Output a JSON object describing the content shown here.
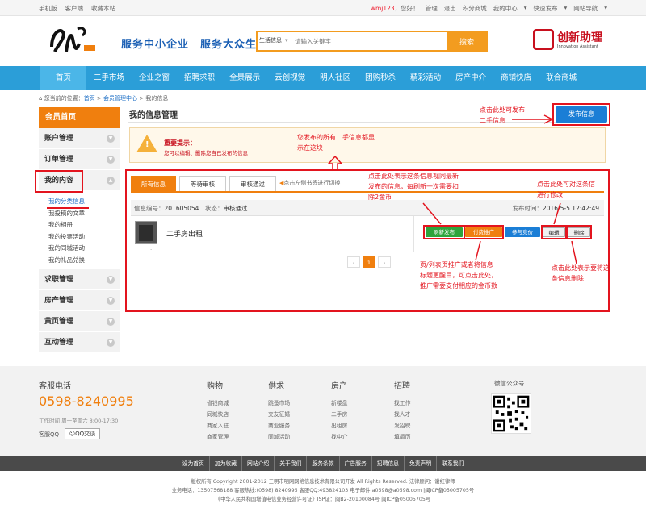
{
  "topbar": {
    "left": [
      "手机版",
      "客户端",
      "收藏本站"
    ],
    "user": "wmj123",
    "greeting": "，您好！",
    "right": [
      "管理",
      "退出",
      "积分商城",
      "我的中心",
      "快速发布",
      "网站导航"
    ]
  },
  "header": {
    "slogan": "服务中小企业　服务大众生活",
    "search_category": "生活信息",
    "search_placeholder": "请输入关键字",
    "search_button": "搜索",
    "brand_title": "创新助理",
    "brand_sub": "Innovation Assistant"
  },
  "nav": [
    "首页",
    "二手市场",
    "企业之窗",
    "招聘求职",
    "全景展示",
    "云创视觉",
    "明人社区",
    "团购秒杀",
    "精彩活动",
    "房产中介",
    "商铺快店",
    "联合商城"
  ],
  "breadcrumb": {
    "prefix": "您当前的位置：",
    "items": [
      "首页",
      "会员管理中心",
      "我的信息"
    ]
  },
  "sidebar": {
    "head": "会员首页",
    "groups": [
      "账户管理",
      "订单管理",
      "我的内容"
    ],
    "sub": [
      "我的分类信息",
      "我投稿的文章",
      "我的相册",
      "我的投票活动",
      "我的同城活动",
      "我的礼品兑换"
    ],
    "groups2": [
      "求职管理",
      "房产管理",
      "黄页管理",
      "互动管理"
    ]
  },
  "main": {
    "title": "我的信息管理",
    "publish_button": "发布信息",
    "notice_title": "重要提示：",
    "notice_text": "您可以编辑、删除您自己发布的信息",
    "tabs": [
      "所有信息",
      "等待审核",
      "审核通过"
    ],
    "tab_hint": "点击左侧书签进行切换",
    "item": {
      "id_label": "信息编号：",
      "id": "201605054",
      "status_label": "状态：",
      "status": "审核通过",
      "time_label": "发布时间：",
      "time": "2016-5-5 12:42:49",
      "title": "二手房出租",
      "dot": "."
    },
    "buttons": [
      "刷新发布",
      "付费推广",
      "参与竞价",
      "编辑",
      "删除"
    ],
    "pager": [
      "‹",
      "1",
      "›"
    ]
  },
  "annotations": {
    "publish": "点击此处可发布二手信息",
    "panel": "您发布的所有二手信息都显示在这块",
    "refresh": "点击此处表示这条信息视同最新发布的信息，每刷新一次需要扣除2金币",
    "edit": "点击此处可对这条信进行修改",
    "promote": "页/列表页推广或者将信息标题更醒目，可点击此处，推广需要支付相应的金币数",
    "delete": "点击此处表示要将这条信息删除"
  },
  "footer": {
    "service_label": "客服电话",
    "phone": "0598-8240995",
    "hours": "工作时间 周一至周六 8:00-17:30",
    "qq_label": "客服QQ",
    "qq_button": "QQ交谈",
    "cols": [
      {
        "h": "购物",
        "l": [
          "省钱商城",
          "同城快店",
          "商家入驻",
          "商家管理"
        ]
      },
      {
        "h": "供求",
        "l": [
          "跳蚤市场",
          "交友征婚",
          "商业服务",
          "同城活动"
        ]
      },
      {
        "h": "房产",
        "l": [
          "新楼盘",
          "二手房",
          "出租房",
          "找中介"
        ]
      },
      {
        "h": "招聘",
        "l": [
          "找工作",
          "找人才",
          "发招聘",
          "填简历"
        ]
      }
    ],
    "wechat": "微信公众号",
    "bottom_links": [
      "设为首页",
      "加为收藏",
      "网站介绍",
      "关于我们",
      "服务条款",
      "广告服务",
      "招聘信息",
      "免责声明",
      "联系我们"
    ],
    "copy1": "版权所有 Copyright 2001-2012 三明市明网网络信息技术有限公司开发 All Rights Reserved. 法律顾问：谢红律师",
    "copy2": "业务电话：13507568188 客服热线:(0598) 8240995 客服QQ:493824103 电子邮件:a0598@a0598.com |闽ICP备05005705号",
    "copy3": "《中华人民共和国增值电信业务经营许可证》ISP证：闽B2-20100084号 闽ICP备05005705号"
  },
  "colors": {
    "orange": "#f07f0e",
    "nav_blue": "#2b9ed8",
    "annot_red": "#e3141e",
    "button_blue": "#1a7ed6",
    "green": "#2ea43c"
  }
}
